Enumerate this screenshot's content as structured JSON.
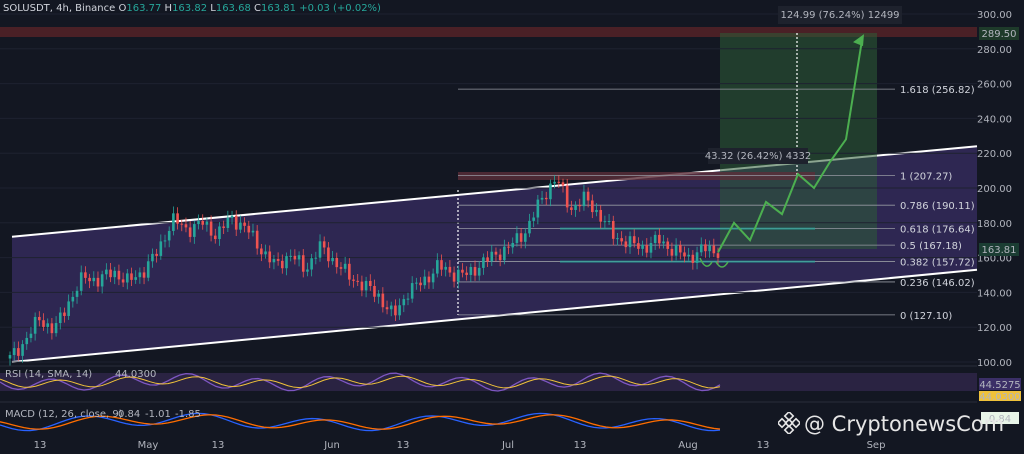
{
  "header": {
    "symbol": "SOLUSDT, 4h, Binance",
    "open_label": "O",
    "open": "163.77",
    "high_label": "H",
    "high": "163.82",
    "low_label": "L",
    "low": "163.68",
    "close_label": "C",
    "close": "163.81",
    "change": "+0.03 (+0.02%)"
  },
  "chart_data": {
    "type": "line",
    "title": "",
    "xlabel": "",
    "ylabel": "",
    "ylim": [
      90,
      305
    ],
    "y_ticks": [
      "300.00",
      "280.00",
      "260.00",
      "240.00",
      "220.00",
      "200.00",
      "180.00",
      "160.00",
      "140.00",
      "120.00",
      "100.00"
    ],
    "x_ticks": [
      "13",
      "May",
      "13",
      "Jun",
      "13",
      "Jul",
      "13",
      "Aug",
      "13",
      "Sep"
    ],
    "series": [
      {
        "values": [
          102,
          112,
          125,
          118,
          135,
          149,
          147,
          152,
          146,
          152,
          163,
          182,
          176,
          180,
          173,
          183,
          177,
          165,
          155,
          162,
          153,
          166,
          158,
          149,
          144,
          138,
          126,
          141,
          146,
          155,
          151,
          150,
          157,
          162,
          167,
          176,
          193,
          206,
          188,
          194,
          184,
          172,
          168,
          166,
          170,
          164,
          160,
          165,
          163.81
        ]
      }
    ],
    "channel": {
      "upper": [
        172,
        224
      ],
      "lower": [
        100,
        153
      ]
    },
    "fib_levels": [
      {
        "label": "0 (127.10)",
        "value": 127.1
      },
      {
        "label": "0.236 (146.02)",
        "value": 146.02
      },
      {
        "label": "0.382 (157.72)",
        "value": 157.72
      },
      {
        "label": "0.5 (167.18)",
        "value": 167.18
      },
      {
        "label": "0.618 (176.64)",
        "value": 176.64
      },
      {
        "label": "0.786 (190.11)",
        "value": 190.11
      },
      {
        "label": "1 (207.27)",
        "value": 207.27
      },
      {
        "label": "1.618 (256.82)",
        "value": 256.82
      }
    ],
    "target_price": "289.50",
    "current_price": "163.81",
    "measure_top": "124.99 (76.24%) 12499",
    "measure_mid": "43.32 (26.42%) 4332",
    "projection": [
      163,
      180,
      170,
      192,
      185,
      208,
      200,
      215,
      228,
      285
    ],
    "rsi": {
      "label": "RSI (14, SMA, 14)",
      "value": "44.5275",
      "sma_value": "44.0300"
    },
    "macd": {
      "label": "MACD (12, 26, close, 9)",
      "macd": "0.84",
      "signal": "-1.01",
      "hist": "-1.85"
    }
  },
  "watermark": "@ CryptonewsCom",
  "colors": {
    "bg": "#131722",
    "channel": "#3b2f67",
    "up": "#26a69a",
    "down": "#ef5350",
    "projection": "#4caf50",
    "target_zone": "#4a2026",
    "rsi": "#7e57c2",
    "rsi_sma": "#f0c23a",
    "macd": "#2962ff",
    "signal": "#ff6d00"
  }
}
